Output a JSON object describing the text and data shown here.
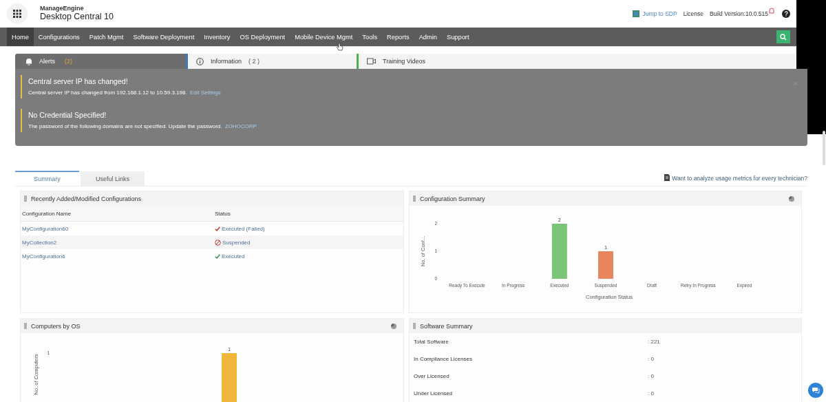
{
  "header": {
    "brand": "ManageEngine",
    "product": "Desktop Central 10",
    "links": [
      {
        "kind": "sdp",
        "label": "Jump to SDP"
      },
      {
        "kind": "plain",
        "label": "License"
      },
      {
        "kind": "plain",
        "label": "Build Version:10.0.515"
      }
    ]
  },
  "nav": [
    {
      "label": "Home",
      "selected": true
    },
    {
      "label": "Configurations",
      "selected": false
    },
    {
      "label": "Patch Mgmt",
      "selected": false
    },
    {
      "label": "Software Deployment",
      "selected": false
    },
    {
      "label": "Inventory",
      "selected": false
    },
    {
      "label": "OS Deployment",
      "selected": false
    },
    {
      "label": "Mobile Device Mgmt",
      "selected": false
    },
    {
      "label": "Tools",
      "selected": false
    },
    {
      "label": "Reports",
      "selected": false
    },
    {
      "label": "Admin",
      "selected": false
    },
    {
      "label": "Support",
      "selected": false
    }
  ],
  "notice_tabs": [
    {
      "kind": "alerts",
      "label": "Alerts",
      "count": "(2)",
      "selected": true
    },
    {
      "kind": "info",
      "label": "Information",
      "count": "( 2 )",
      "selected": false
    },
    {
      "kind": "video",
      "label": "Training Videos",
      "selected": false
    }
  ],
  "alerts": [
    {
      "title": "Central server IP has changed!",
      "text": "Central server IP has changed from 192.168.1.12 to 10.59.3.198.",
      "link": "Edit Settings"
    },
    {
      "title": "No Credential Specified!",
      "text": "The password of the following domains are not specified. Update the password.",
      "link": "ZOHOCORP"
    }
  ],
  "dash_tabs": [
    {
      "label": "Summary",
      "selected": true
    },
    {
      "label": "Useful Links",
      "selected": false
    }
  ],
  "usage_link": "Want to analyze usage metrics for every technician?",
  "recent": {
    "title": "Recently Added/Modified Configurations",
    "columns": [
      "Configuration Name",
      "Status"
    ],
    "rows": [
      {
        "name": "MyConfiguration60",
        "status": "Executed (Failed)",
        "kind": "failed"
      },
      {
        "name": "MyCollection2",
        "status": "Suspended",
        "kind": "suspended"
      },
      {
        "name": "MyConfiguration6",
        "status": "Executed",
        "kind": "executed"
      }
    ]
  },
  "config_summary": {
    "title": "Configuration Summary",
    "chart_data": {
      "type": "bar",
      "xlabel": "Configuration Status",
      "ylabel": "No. of Conf...",
      "categories": [
        "Ready To Execute",
        "In Progress",
        "Executed",
        "Suspended",
        "Draft",
        "Retry In Progress",
        "Expired"
      ],
      "series": [
        {
          "color": "#7cc576",
          "values": [
            null,
            null,
            2,
            null,
            null,
            null,
            null
          ]
        },
        {
          "color": "#e8845e",
          "values": [
            null,
            null,
            null,
            1,
            null,
            null,
            null
          ]
        }
      ],
      "yticks": [
        0,
        1,
        2
      ],
      "ylim": [
        0,
        2
      ],
      "data_labels": true
    }
  },
  "computers_by_os": {
    "title": "Computers by OS",
    "y_axis_title": "No. of Computers",
    "y_tick": "1",
    "bar_label": "1"
  },
  "software_summary": {
    "title": "Software Summary",
    "rows": [
      {
        "label": "Total Software",
        "value": ": 221"
      },
      {
        "label": "In Compliance Licenses",
        "value": ": 0"
      },
      {
        "label": "Over Licensed",
        "value": ": 0"
      },
      {
        "label": "Under Licensed",
        "value": ": 0"
      }
    ]
  }
}
